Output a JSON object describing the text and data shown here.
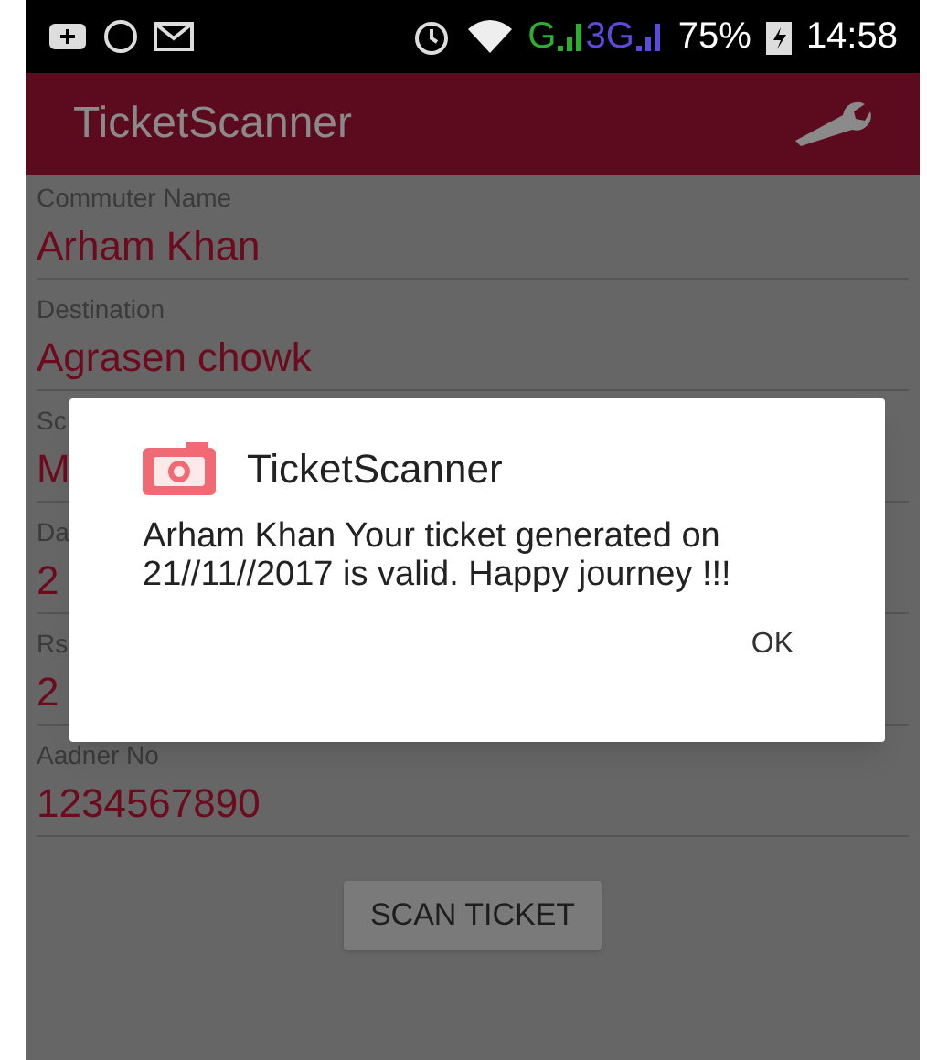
{
  "status_bar": {
    "network_1": "G",
    "network_2": "3G",
    "battery": "75%",
    "time": "14:58"
  },
  "app_bar": {
    "title": "TicketScanner"
  },
  "fields": [
    {
      "label": "Commuter Name",
      "value": "Arham Khan"
    },
    {
      "label": "Destination",
      "value": "Agrasen chowk"
    },
    {
      "label": "Sc",
      "value": "M"
    },
    {
      "label": "Da",
      "value": "2"
    },
    {
      "label": "Rs",
      "value": "2"
    },
    {
      "label": "Aadner No",
      "value": "1234567890"
    }
  ],
  "scan_button": "SCAN TICKET",
  "dialog": {
    "title": "TicketScanner",
    "message": "Arham Khan Your ticket generated on  21//11//2017 is valid. Happy journey !!!",
    "button": "OK"
  }
}
